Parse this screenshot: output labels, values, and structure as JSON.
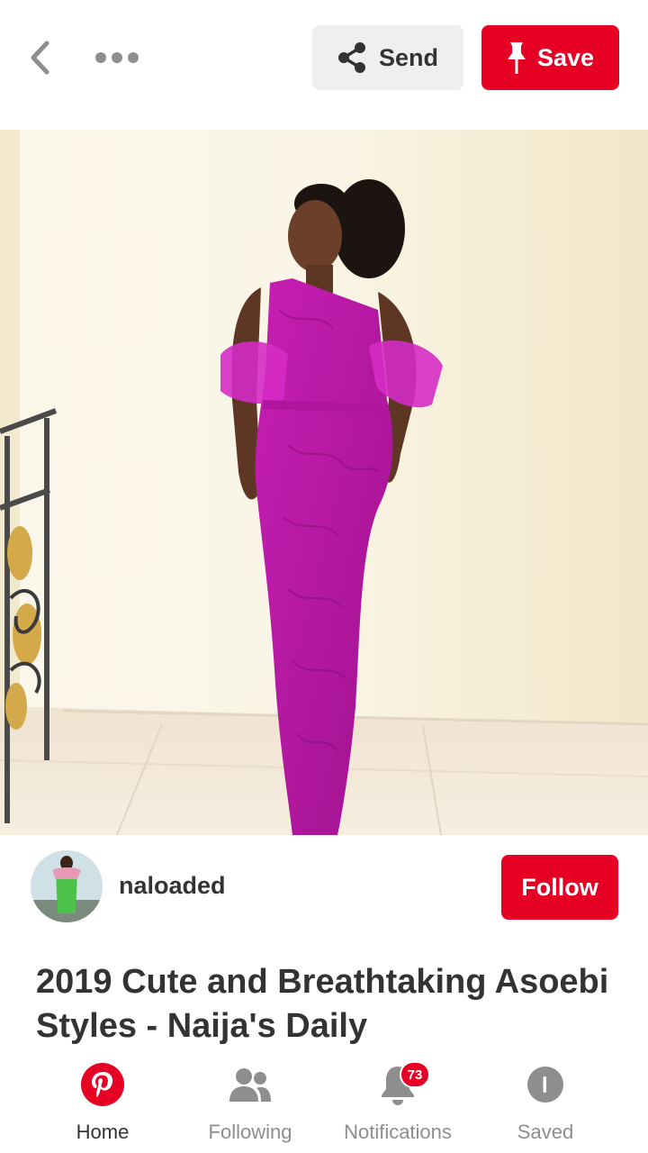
{
  "header": {
    "back_icon": "chevron-left-icon",
    "more_icon": "ellipsis-icon",
    "send_label": "Send",
    "send_icon": "share-icon",
    "save_label": "Save",
    "save_icon": "pushpin-icon"
  },
  "pin": {
    "image_alt": "Woman in magenta lace one-shoulder gown",
    "lens_icon": "visual-search-icon"
  },
  "creator": {
    "username": "naloaded",
    "follow_label": "Follow"
  },
  "title": "2019 Cute and Breathtaking Asoebi Styles - Naija's Daily",
  "nav": {
    "home": {
      "label": "Home",
      "icon": "pinterest-logo-icon"
    },
    "following": {
      "label": "Following",
      "icon": "people-icon"
    },
    "notifications": {
      "label": "Notifications",
      "icon": "bell-icon",
      "badge": "73"
    },
    "saved": {
      "label": "Saved",
      "icon": "profile-icon"
    }
  },
  "colors": {
    "brand_red": "#e60023",
    "text_dark": "#333333",
    "text_muted": "#8e8e8e",
    "send_bg": "#efefef"
  }
}
